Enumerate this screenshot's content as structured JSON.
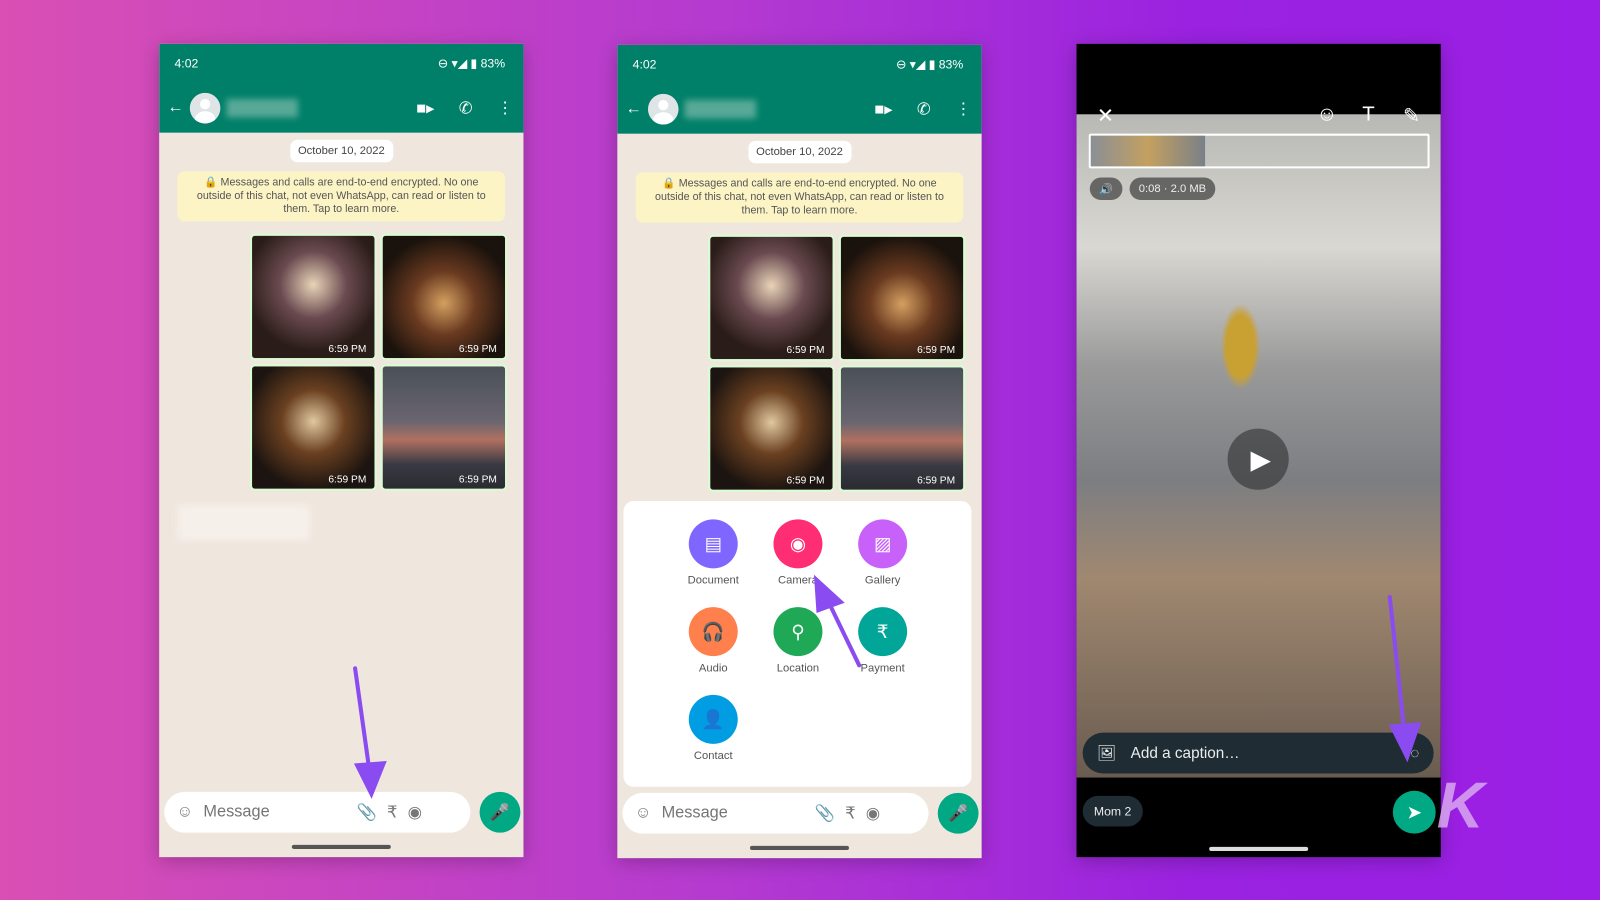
{
  "status": {
    "time": "4:02",
    "battery": "83%"
  },
  "chat": {
    "date": "October 10, 2022",
    "encryption_notice": "Messages and calls are end-to-end encrypted. No one outside of this chat, not even WhatsApp, can read or listen to them. Tap to learn more.",
    "timestamps": [
      "6:59 PM",
      "6:59 PM",
      "6:59 PM",
      "6:59 PM"
    ],
    "input_placeholder": "Message"
  },
  "attach_menu": [
    {
      "label": "Document",
      "color": "#7f66ff",
      "icon": "document-icon"
    },
    {
      "label": "Camera",
      "color": "#ff2e74",
      "icon": "camera-icon"
    },
    {
      "label": "Gallery",
      "color": "#c861fa",
      "icon": "gallery-icon"
    },
    {
      "label": "Audio",
      "color": "#ff7f4d",
      "icon": "headphones-icon"
    },
    {
      "label": "Location",
      "color": "#1fa855",
      "icon": "location-icon"
    },
    {
      "label": "Payment",
      "color": "#02a698",
      "icon": "rupee-icon"
    },
    {
      "label": "Contact",
      "color": "#009de2",
      "icon": "contact-icon"
    }
  ],
  "editor": {
    "duration": "0:08",
    "size": "2.0 MB",
    "caption_placeholder": "Add a caption…",
    "recipient": "Mom 2"
  },
  "colors": {
    "whatsapp_green": "#008069",
    "accent": "#00a884",
    "arrow": "#8a4cf0"
  },
  "watermark": "K"
}
